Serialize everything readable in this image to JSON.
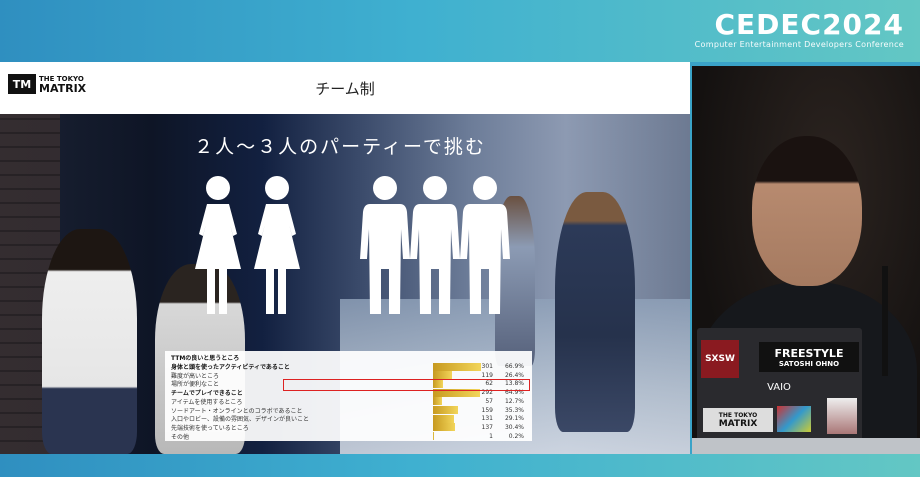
{
  "brand": {
    "title": "CEDEC2024",
    "subtitle": "Computer Entertainment Developers Conference"
  },
  "slide": {
    "logo_mark": "TM",
    "logo_top": "THE TOKYO",
    "logo_bottom": "MATRIX",
    "title": "チーム制",
    "subtitle": "２人〜３人のパーティーで挑む"
  },
  "survey": {
    "header": "TTMの良いと思うところ",
    "rows": [
      {
        "label": "身体と頭を使ったアクティビティであること",
        "count": "301",
        "pct": "66.9%",
        "frac": 0.669,
        "bold": true
      },
      {
        "label": "難度が高いところ",
        "count": "119",
        "pct": "26.4%",
        "frac": 0.264
      },
      {
        "label": "場所が便利なこと",
        "count": "62",
        "pct": "13.8%",
        "frac": 0.138
      },
      {
        "label": "チームでプレイできること",
        "count": "292",
        "pct": "64.9%",
        "frac": 0.649,
        "bold": true
      },
      {
        "label": "アイテムを使用するところ",
        "count": "57",
        "pct": "12.7%",
        "frac": 0.127
      },
      {
        "label": "ソードアート・オンラインとのコラボであること",
        "count": "159",
        "pct": "35.3%",
        "frac": 0.353
      },
      {
        "label": "入口やロビー、設備の雰囲気、デザインが良いこと",
        "count": "131",
        "pct": "29.1%",
        "frac": 0.291
      },
      {
        "label": "先端技術を使っているところ",
        "count": "137",
        "pct": "30.4%",
        "frac": 0.304
      },
      {
        "label": "その他",
        "count": "1",
        "pct": "0.2%",
        "frac": 0.002
      }
    ]
  },
  "speaker": {
    "sticker_brand": "FREESTYLE",
    "sticker_name": "SATOSHI OHNO",
    "sticker_sxsw": "SXSW",
    "laptop_brand": "VAIO",
    "logo_top": "THE TOKYO",
    "logo_bottom": "MATRIX"
  },
  "colors": {
    "banner": "#3fb0d0",
    "bar": "#f2d55a",
    "highlight": "#dd2222"
  }
}
